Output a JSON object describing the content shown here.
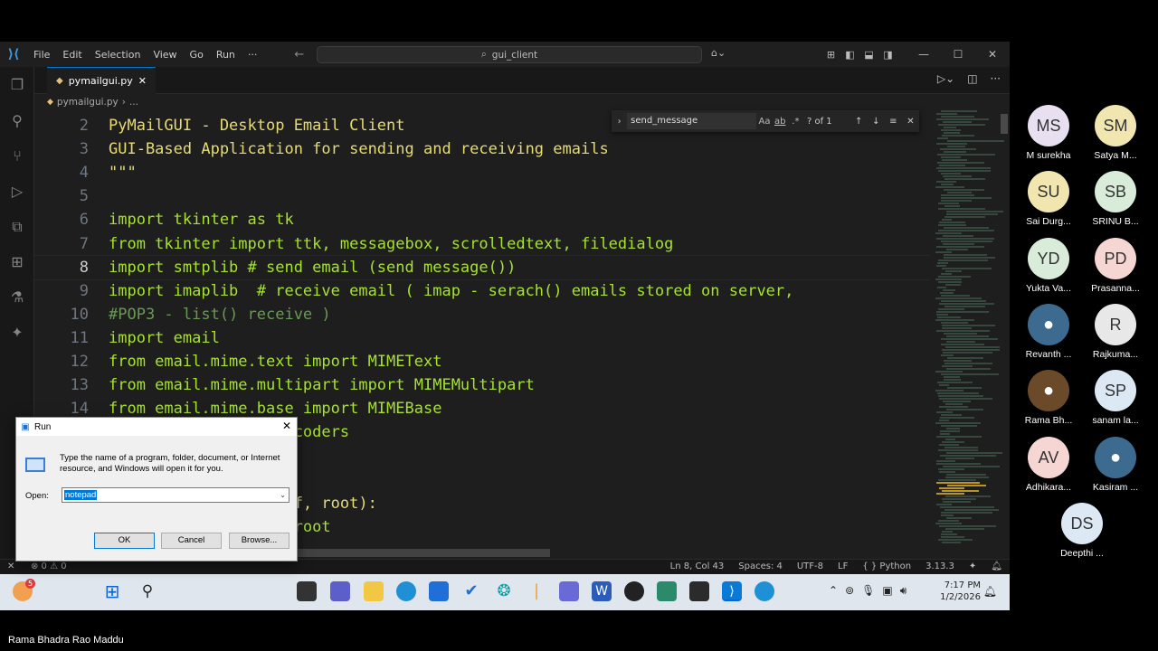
{
  "window": {
    "menu": [
      "File",
      "Edit",
      "Selection",
      "View",
      "Go",
      "Run",
      "···"
    ],
    "search_text": "gui_client",
    "minimize": "—",
    "maximize": "☐",
    "close": "✕"
  },
  "tab": {
    "filename": "pymailgui.py",
    "close": "✕"
  },
  "breadcrumb": {
    "file": "pymailgui.py",
    "sep": "›",
    "rest": "..."
  },
  "find": {
    "query": "send_message",
    "match_case": "Aa",
    "whole_word": "ab",
    "regex": ".*",
    "count": "? of 1"
  },
  "code_lines": [
    {
      "num": "2",
      "text": "PyMailGUI - Desktop Email Client",
      "color": "#e6db74"
    },
    {
      "num": "3",
      "text": "GUI-Based Application for sending and receiving emails",
      "color": "#e6db74"
    },
    {
      "num": "4",
      "text": "\"\"\"",
      "color": "#e6db74"
    },
    {
      "num": "5",
      "text": "",
      "color": "#cccccc"
    },
    {
      "num": "6",
      "text": "import tkinter as tk",
      "color": "#a6e22e"
    },
    {
      "num": "7",
      "text": "from tkinter import ttk, messagebox, scrolledtext, filedialog",
      "color": "#a6e22e"
    },
    {
      "num": "8",
      "text": "import smtplib # send email (send message())",
      "color": "#a6e22e",
      "current": true
    },
    {
      "num": "9",
      "text": "import imaplib  # receive email ( imap - serach() emails stored on server,",
      "color": "#a6e22e"
    },
    {
      "num": "10",
      "text": "#POP3 - list() receive )",
      "color": "#6a9955"
    },
    {
      "num": "11",
      "text": "import email",
      "color": "#a6e22e"
    },
    {
      "num": "12",
      "text": "from email.mime.text import MIMEText",
      "color": "#a6e22e"
    },
    {
      "num": "13",
      "text": "from email.mime.multipart import MIMEMultipart",
      "color": "#a6e22e"
    },
    {
      "num": "14",
      "text": "from email.mime.base import MIMEBase",
      "color": "#a6e22e"
    },
    {
      "num": "15",
      "text": "from email import encoders",
      "color": "#a6e22e"
    },
    {
      "num": "16",
      "text": "",
      "color": "#cccccc"
    },
    {
      "num": "17",
      "text": "",
      "color": "#cccccc"
    },
    {
      "num": "18",
      "text": "    def __init__(self, root):",
      "color": "#e6db74"
    },
    {
      "num": "19",
      "text": "        self.root = root",
      "color": "#a6e22e"
    }
  ],
  "status": {
    "remote": "✕",
    "problems": "⊗ 0 ⚠ 0",
    "position": "Ln 8, Col 43",
    "spaces": "Spaces: 4",
    "encoding": "UTF-8",
    "eol": "LF",
    "language": "{ } Python",
    "version": "3.13.3"
  },
  "taskbar": {
    "time": "7:17 PM",
    "date": "1/2/2026",
    "badge": "5"
  },
  "run_dialog": {
    "title": "Run",
    "description": "Type the name of a program, folder, document, or Internet resource, and Windows will open it for you.",
    "open_label": "Open:",
    "input_value": "notepad",
    "ok": "OK",
    "cancel": "Cancel",
    "browse": "Browse..."
  },
  "participants": [
    {
      "initials": "MS",
      "name": "M surekha",
      "color": "#e8e0f0"
    },
    {
      "initials": "SM",
      "name": "Satya M...",
      "color": "#f2e6b0"
    },
    {
      "initials": "SU",
      "name": "Sai Durg...",
      "color": "#f2e6b0"
    },
    {
      "initials": "SB",
      "name": "SRINU B...",
      "color": "#d9ecd9"
    },
    {
      "initials": "YD",
      "name": "Yukta Va...",
      "color": "#d9ecd9"
    },
    {
      "initials": "PD",
      "name": "Prasanna...",
      "color": "#f6d6d2"
    },
    {
      "initials": "",
      "name": "Revanth ...",
      "color": "#3d6b8f"
    },
    {
      "initials": "R",
      "name": "Rajkuma...",
      "color": "#e8e8e8"
    },
    {
      "initials": "",
      "name": "Rama Bh...",
      "color": "#6b4a2a"
    },
    {
      "initials": "SP",
      "name": "sanam la...",
      "color": "#dde8f5"
    },
    {
      "initials": "AV",
      "name": "Adhikara...",
      "color": "#f6d6d2"
    },
    {
      "initials": "",
      "name": "Kasiram ...",
      "color": "#3d6b8f"
    },
    {
      "initials": "DS",
      "name": "Deepthi ...",
      "color": "#dde8f5"
    }
  ],
  "presenter": "Rama Bhadra Rao Maddu"
}
